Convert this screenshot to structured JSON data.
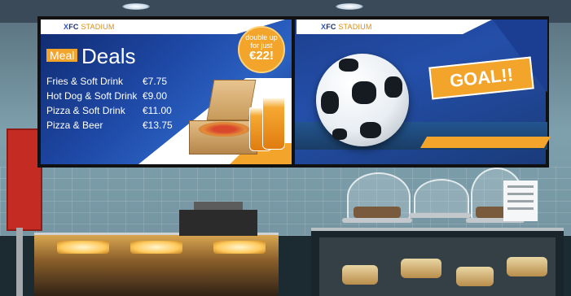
{
  "left_screen": {
    "brand_x": "X",
    "brand_fc": "FC",
    "brand_stadium": "STADIUM",
    "meal_tag": "Meal",
    "title": "Deals",
    "menu": [
      {
        "item": "Fries & Soft Drink",
        "price": "€7.75"
      },
      {
        "item": "Hot Dog & Soft Drink",
        "price": "€9.00"
      },
      {
        "item": "Pizza & Soft Drink",
        "price": "€11.00"
      },
      {
        "item": "Pizza & Beer",
        "price": "€13.75"
      }
    ],
    "badge_line1": "double up",
    "badge_line2": "for just",
    "badge_price": "€22!"
  },
  "right_screen": {
    "brand_x": "X",
    "brand_fc": "FC",
    "brand_stadium": "STADIUM",
    "goal_text": "GOAL!!"
  },
  "colors": {
    "accent_orange": "#f2a52a",
    "brand_blue": "#1f4aa8"
  }
}
